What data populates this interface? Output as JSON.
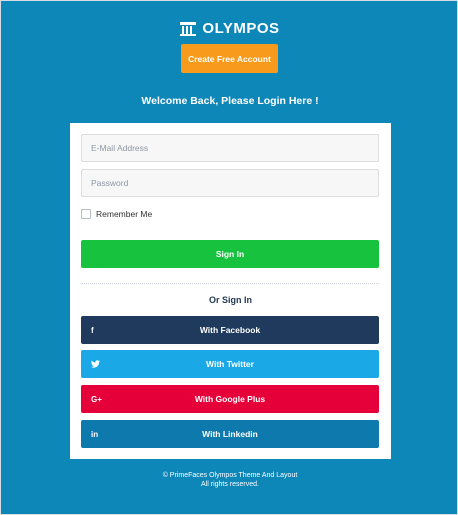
{
  "brand": {
    "name": "OLYMPOS"
  },
  "header": {
    "create_account_label": "Create Free Account",
    "welcome": "Welcome Back, Please Login Here !"
  },
  "form": {
    "email_placeholder": "E-Mail Address",
    "email_value": "",
    "password_placeholder": "Password",
    "password_value": "",
    "remember_label": "Remember Me",
    "remember_checked": false,
    "signin_label": "Sign In",
    "or_signin": "Or Sign In"
  },
  "social": [
    {
      "label": "With Facebook",
      "icon": "facebook-icon",
      "glyph": "f",
      "color": "#1f3a5c"
    },
    {
      "label": "With Twitter",
      "icon": "twitter-icon",
      "glyph": "",
      "color": "#1aa9e6"
    },
    {
      "label": "With Google Plus",
      "icon": "google-plus-icon",
      "glyph": "G+",
      "color": "#e6003a"
    },
    {
      "label": "With Linkedin",
      "icon": "linkedin-icon",
      "glyph": "in",
      "color": "#0e79ad"
    }
  ],
  "footer": {
    "line1": "© PrimeFaces Olympos Theme And Layout",
    "line2": "All rights reserved."
  },
  "colors": {
    "background": "#0d86b8",
    "accent_orange": "#f89a1c",
    "signin_green": "#17c23f"
  }
}
